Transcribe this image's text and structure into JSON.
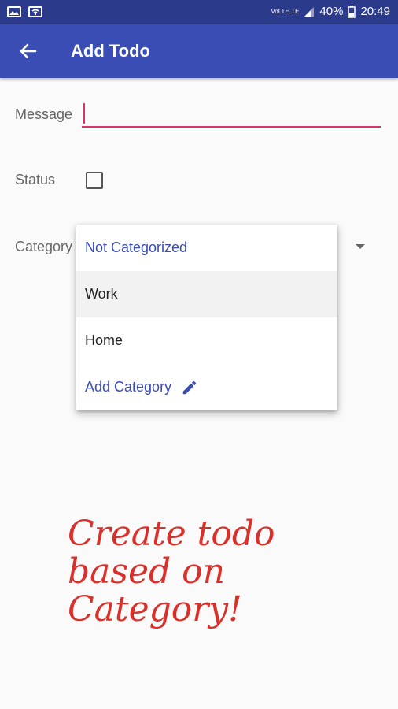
{
  "status_bar": {
    "left_icons": [
      "image-icon",
      "wifi-icon"
    ],
    "network": "VoLTE",
    "lte": "LTE",
    "battery": "40%",
    "time": "20:49"
  },
  "app_bar": {
    "title": "Add Todo",
    "back_icon": "arrow-left-icon",
    "color": "#3a4db4"
  },
  "form": {
    "message_label": "Message",
    "message_value": "",
    "status_label": "Status",
    "status_checked": false,
    "category_label": "Category"
  },
  "category_menu": {
    "items": [
      "Not Categorized",
      "Work",
      "Home"
    ],
    "selected": "Not Categorized",
    "add_label": "Add Category",
    "add_icon": "pencil-icon"
  },
  "annotation": {
    "lines": [
      "Create todo",
      "based on",
      "Category!"
    ],
    "color": "#d8302a"
  },
  "colors": {
    "accent": "#d6346a",
    "primary": "#3a4db4",
    "primary_dark": "#2c3a8c"
  }
}
